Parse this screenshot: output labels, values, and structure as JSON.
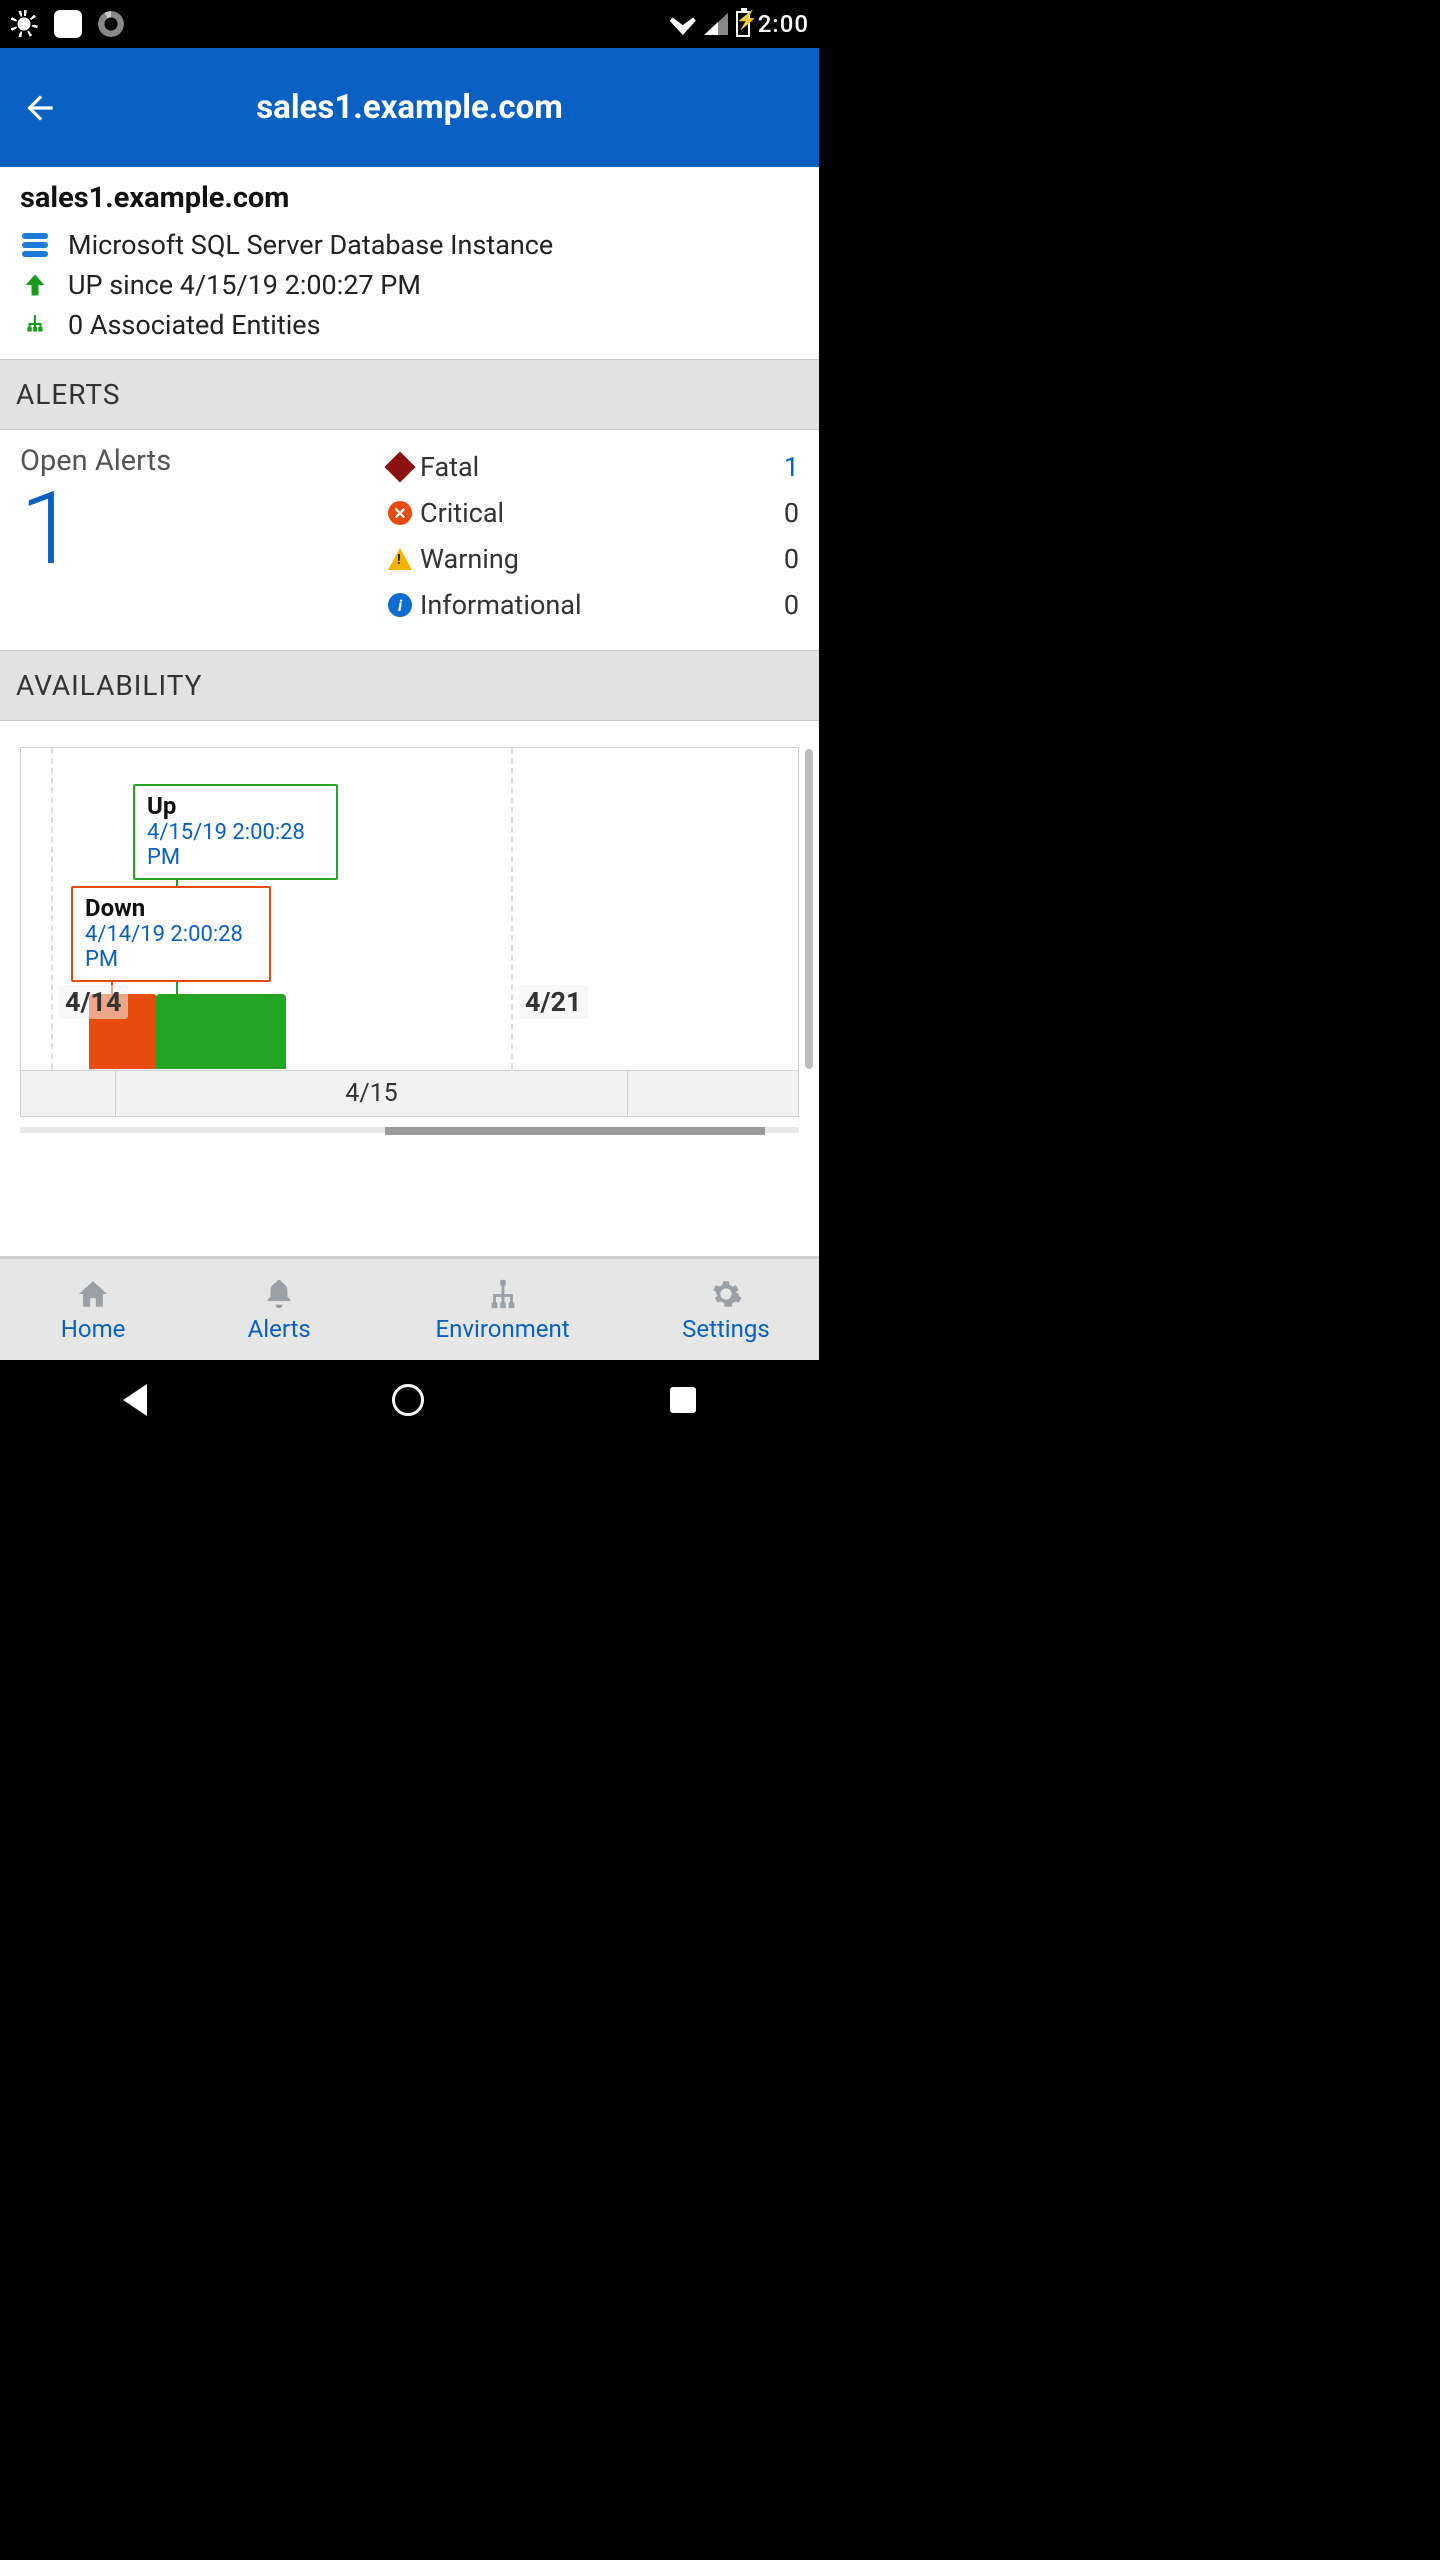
{
  "status": {
    "time": "2:00"
  },
  "header": {
    "title": "sales1.example.com"
  },
  "host": {
    "name": "sales1.example.com",
    "type": "Microsoft SQL Server Database Instance",
    "status_line": "UP since 4/15/19 2:00:27 PM",
    "entities_line": "0 Associated Entities"
  },
  "sections": {
    "alerts": "ALERTS",
    "availability": "AVAILABILITY"
  },
  "alerts": {
    "open_label": "Open Alerts",
    "open_count": "1",
    "severities": {
      "fatal": {
        "label": "Fatal",
        "count": "1"
      },
      "critical": {
        "label": "Critical",
        "count": "0"
      },
      "warning": {
        "label": "Warning",
        "count": "0"
      },
      "informational": {
        "label": "Informational",
        "count": "0"
      }
    }
  },
  "chart_data": {
    "type": "bar",
    "title": "Availability",
    "xlabel": "",
    "ylabel": "",
    "categories": [
      "4/14",
      "4/15",
      "4/21"
    ],
    "axis_bottom_label": "4/15",
    "series": [
      {
        "name": "Down",
        "color": "#e74c0e",
        "values": [
          1,
          0,
          0
        ]
      },
      {
        "name": "Up",
        "color": "#22a522",
        "values": [
          0,
          1,
          0
        ]
      }
    ],
    "annotations": [
      {
        "state": "Up",
        "timestamp": "4/15/19 2:00:28 PM"
      },
      {
        "state": "Down",
        "timestamp": "4/14/19 2:00:28 PM"
      }
    ]
  },
  "tabs": {
    "home": "Home",
    "alerts": "Alerts",
    "environment": "Environment",
    "settings": "Settings"
  }
}
